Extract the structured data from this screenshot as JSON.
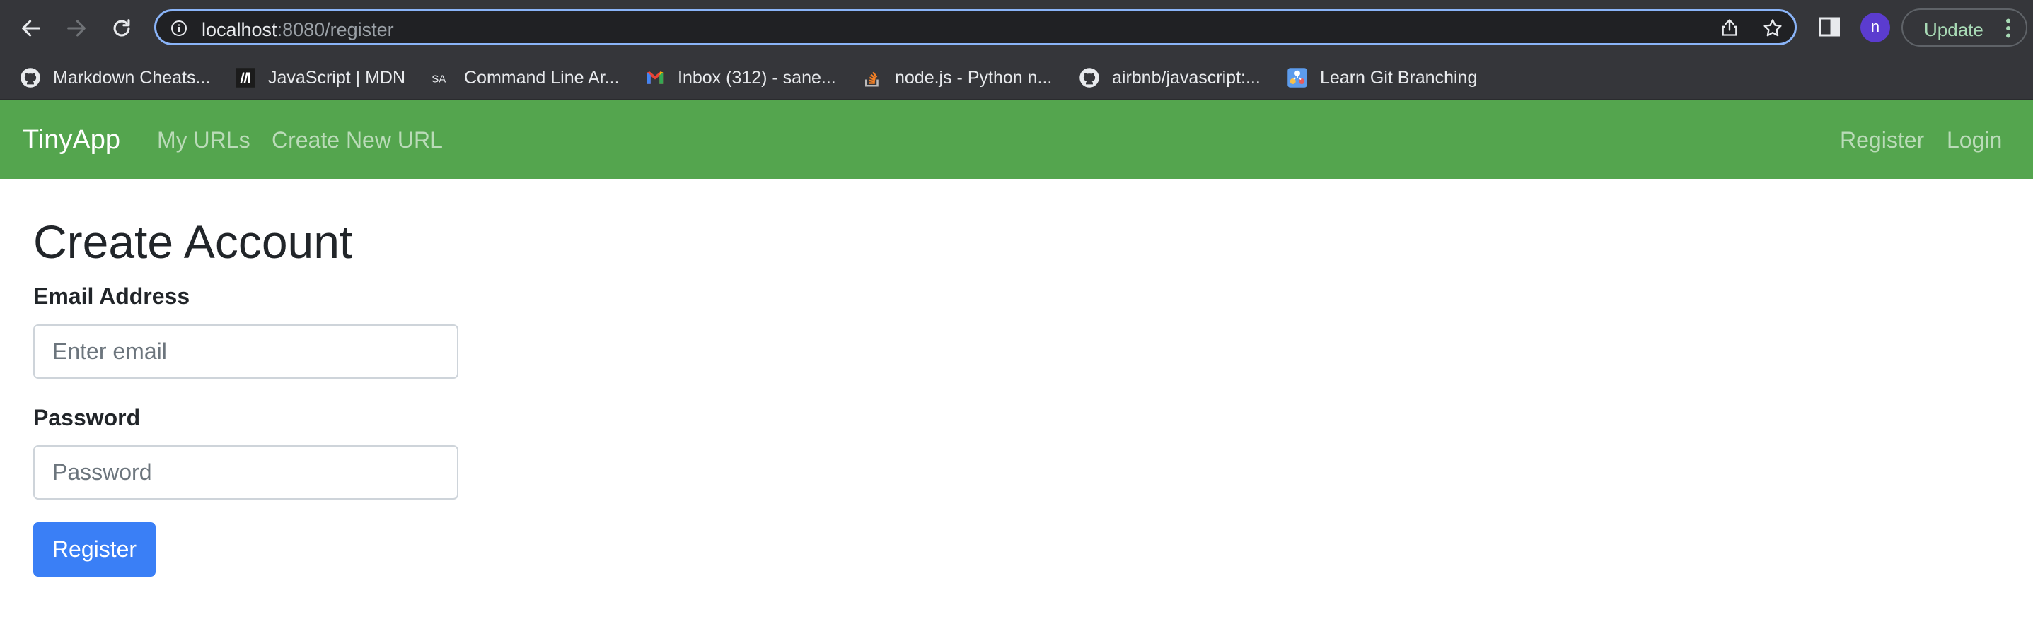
{
  "browser": {
    "url_host": "localhost",
    "url_path": ":8080/register",
    "profile_initial": "n",
    "update_label": "Update",
    "bookmarks": [
      {
        "label": "Markdown Cheats...",
        "icon": "github-icon"
      },
      {
        "label": "JavaScript | MDN",
        "icon": "mdn-icon"
      },
      {
        "label": "Command Line Ar...",
        "icon": "sa-icon",
        "icon_text": "SA"
      },
      {
        "label": "Inbox (312) - sane...",
        "icon": "gmail-icon"
      },
      {
        "label": "node.js - Python n...",
        "icon": "stackoverflow-icon"
      },
      {
        "label": "airbnb/javascript:...",
        "icon": "github-icon"
      },
      {
        "label": "Learn Git Branching",
        "icon": "git-branching-icon"
      }
    ]
  },
  "app": {
    "brand": "TinyApp",
    "nav_left": [
      "My URLs",
      "Create New URL"
    ],
    "nav_right": [
      "Register",
      "Login"
    ],
    "accent_color": "#54a54e"
  },
  "form": {
    "title": "Create Account",
    "email_label": "Email Address",
    "email_placeholder": "Enter email",
    "password_label": "Password",
    "password_placeholder": "Password",
    "submit_label": "Register",
    "submit_color": "#3a7ff6"
  }
}
